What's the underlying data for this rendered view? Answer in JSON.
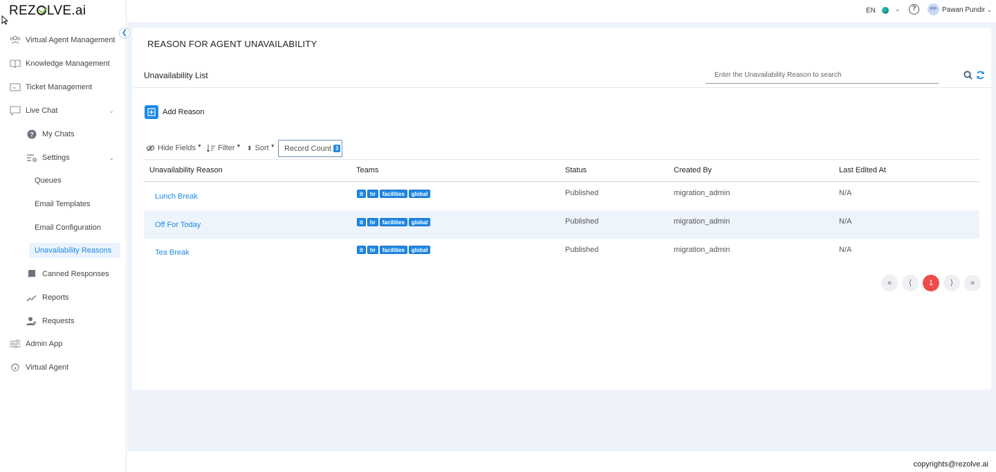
{
  "app": {
    "logo_text": "REZOLVE.ai",
    "logo_pre": "REZ",
    "logo_post": "LVE.ai"
  },
  "topbar": {
    "language": "EN",
    "user_initials": "PP",
    "user_name": "Pawan Pundir"
  },
  "sidebar": {
    "items": [
      {
        "label": "Virtual Agent Management",
        "icon": "users-icon"
      },
      {
        "label": "Knowledge Management",
        "icon": "book-icon"
      },
      {
        "label": "Ticket Management",
        "icon": "ticket-icon"
      },
      {
        "label": "Live Chat",
        "icon": "chat-icon"
      },
      {
        "label": "My Chats",
        "icon": "question-circle-icon"
      },
      {
        "label": "Settings",
        "icon": "settings-icon"
      },
      {
        "label": "Queues"
      },
      {
        "label": "Email Templates"
      },
      {
        "label": "Email Configuration"
      },
      {
        "label": "Unavailability Reasons",
        "active": true
      },
      {
        "label": "Canned Responses",
        "icon": "notebook-icon"
      },
      {
        "label": "Reports",
        "icon": "trend-icon"
      },
      {
        "label": "Requests",
        "icon": "user-add-icon"
      },
      {
        "label": "Admin App",
        "icon": "sliders-icon"
      },
      {
        "label": "Virtual Agent",
        "icon": "agent-icon"
      }
    ]
  },
  "page": {
    "title": "REASON FOR AGENT UNAVAILABILITY",
    "list_title": "Unavailability List",
    "search_placeholder": "Enter the Unavailability Reason to search",
    "add_button": "Add Reason"
  },
  "toolbar": {
    "hide_fields": "Hide Fields",
    "filter": "Filter",
    "sort": "Sort",
    "record_count_label": "Record Count",
    "record_count": "3"
  },
  "table": {
    "headers": [
      "Unavailability Reason",
      "Teams",
      "Status",
      "Created By",
      "Last Edited At"
    ],
    "rows": [
      {
        "reason": "Lunch Break",
        "teams": [
          "it",
          "hr",
          "facilities",
          "global"
        ],
        "status": "Published",
        "created_by": "migration_admin",
        "last_edited": "N/A"
      },
      {
        "reason": "Off For Today",
        "teams": [
          "it",
          "hr",
          "facilities",
          "global"
        ],
        "status": "Published",
        "created_by": "migration_admin",
        "last_edited": "N/A"
      },
      {
        "reason": "Tea Break",
        "teams": [
          "it",
          "hr",
          "facilities",
          "global"
        ],
        "status": "Published",
        "created_by": "migration_admin",
        "last_edited": "N/A"
      }
    ]
  },
  "pagination": {
    "first": "«",
    "prev": "⟨",
    "current": "1",
    "next": "⟩",
    "last": "»"
  },
  "footer": {
    "copyright": "copyrights@rezolve.ai"
  },
  "colors": {
    "accent": "#1e88e5",
    "active_page": "#ef4b4b",
    "background": "#eef3fb"
  }
}
